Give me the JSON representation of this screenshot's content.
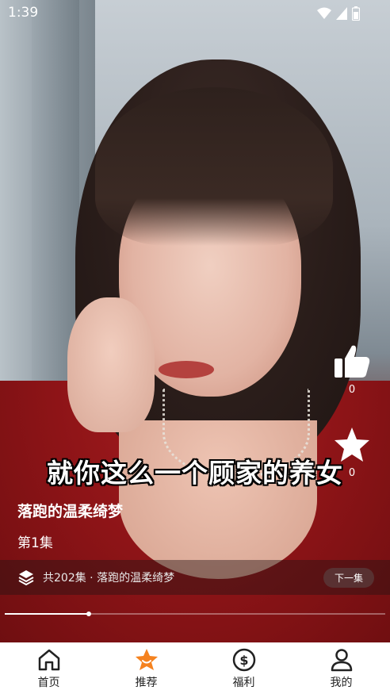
{
  "status_bar": {
    "time": "1:39"
  },
  "video": {
    "subtitle": "就你这么一个顾家的养女"
  },
  "actions": {
    "like_count": "0",
    "favorite_count": "0"
  },
  "drama": {
    "title": "落跑的温柔绮梦",
    "episode": "第1集"
  },
  "series_bar": {
    "info": "共202集 · 落跑的温柔绮梦",
    "next_label": "下一集"
  },
  "playback": {
    "progress": 0.22
  },
  "tabbar": {
    "tabs": [
      {
        "label": "首页",
        "icon": "home-icon"
      },
      {
        "label": "推荐",
        "icon": "star-icon",
        "active": true
      },
      {
        "label": "福利",
        "icon": "dollar-icon"
      },
      {
        "label": "我的",
        "icon": "user-icon"
      }
    ]
  },
  "colors": {
    "accent": "#f5821f",
    "tabbar_bg": "#ffffff"
  }
}
